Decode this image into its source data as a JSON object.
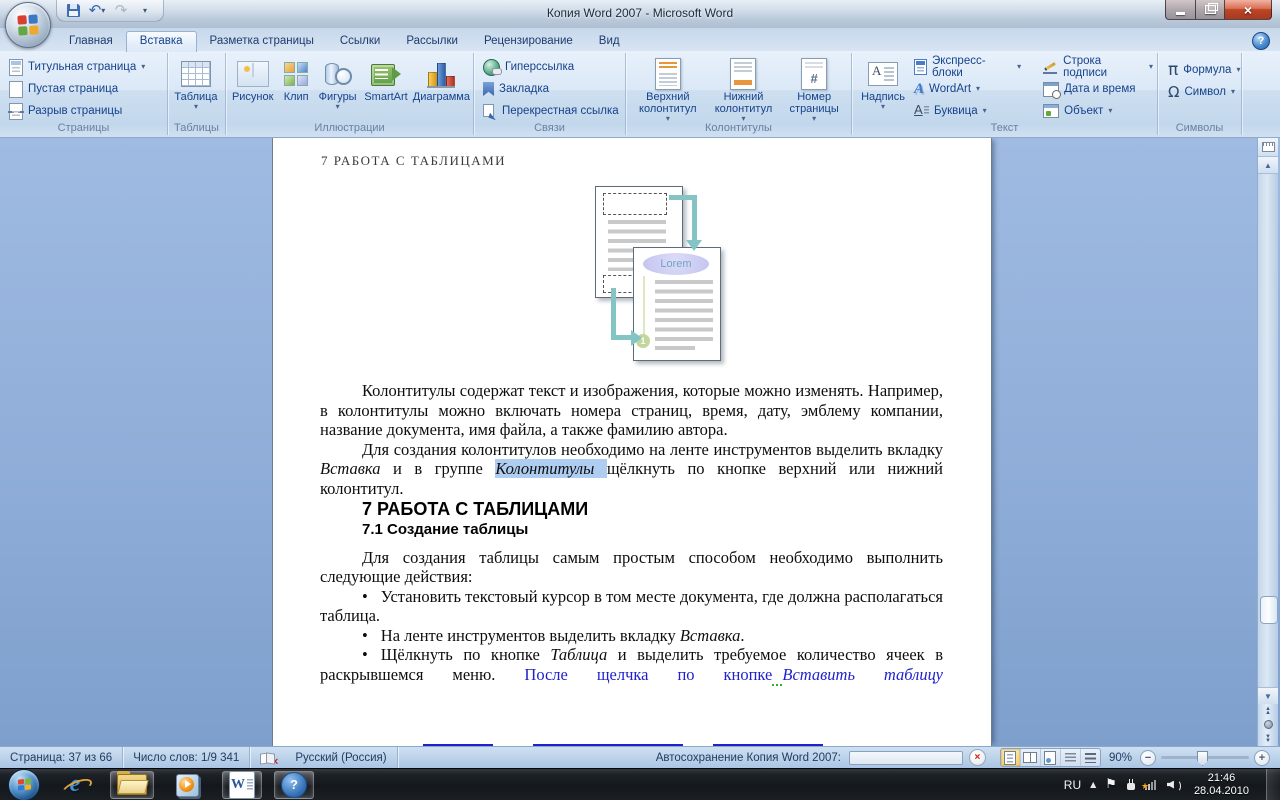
{
  "window": {
    "title": "Копия Word 2007 - Microsoft Word"
  },
  "ribbon": {
    "tabs": [
      "Главная",
      "Вставка",
      "Разметка страницы",
      "Ссылки",
      "Рассылки",
      "Рецензирование",
      "Вид"
    ],
    "groups": {
      "pages": {
        "label": "Страницы",
        "items": [
          "Титульная страница",
          "Пустая страница",
          "Разрыв страницы"
        ]
      },
      "tables": {
        "label": "Таблицы",
        "items": [
          "Таблица"
        ]
      },
      "illustrations": {
        "label": "Иллюстрации",
        "items": [
          "Рисунок",
          "Клип",
          "Фигуры",
          "SmartArt",
          "Диаграмма"
        ]
      },
      "links": {
        "label": "Связи",
        "items": [
          "Гиперссылка",
          "Закладка",
          "Перекрестная ссылка"
        ]
      },
      "header_footer": {
        "label": "Колонтитулы",
        "items": [
          "Верхний колонтитул",
          "Нижний колонтитул",
          "Номер страницы"
        ]
      },
      "text": {
        "label": "Текст",
        "items": [
          "Надпись",
          "Экспресс-блоки",
          "WordArt",
          "Буквица",
          "Строка подписи",
          "Дата и время",
          "Объект"
        ]
      },
      "symbols": {
        "label": "Символы",
        "items": [
          "Формула",
          "Символ"
        ]
      }
    }
  },
  "document": {
    "running_header": "7 РАБОТА С ТАБЛИЦАМИ",
    "figure": {
      "oval_label": "Lorem",
      "badge": "1"
    },
    "para1": "Колонтитулы содержат текст и изображения, которые можно изменять. Например, в колонтитулы можно включать номера страниц, время, дату, эмблему компании, название документа, имя файла, а также фамилию автора.",
    "para2": {
      "r1": "Для создания колонтитулов необходимо на ленте инструментов выделить вкладку ",
      "r2": "Вставка",
      "r3": " и в группе ",
      "r4": "Колонтитулы ",
      "r5": "щёлкнуть по кнопке верхний или нижний колонтитул."
    },
    "heading": "7 РАБОТА С ТАБЛИЦАМИ",
    "subheading": "7.1 Создание таблицы",
    "para3": "Для создания таблицы самым простым способом необходимо выполнить следующие действия:",
    "bullet_char": "•",
    "bullet1": "Установить текстовый курсор в том месте документа, где должна располагаться таблица.",
    "bullet2": {
      "r1": "На ленте инструментов выделить вкладку ",
      "r2": "Вставка",
      "r3": "."
    },
    "bullet3": {
      "r1": "Щёлкнуть по кнопке ",
      "r2": "Таблица",
      "r3": " и выделить требуемое количество ячеек в раскрывшемся меню. ",
      "r4": "После щелчка по кнопке",
      "r5": "Вставить таблицу"
    }
  },
  "status_bar": {
    "page_indicator": "Страница: 37 из 66",
    "word_count": "Число слов: 1/9 341",
    "language": "Русский (Россия)",
    "autosave_label": "Автосохранение Копия Word 2007:",
    "zoom_level": "90%"
  },
  "tray": {
    "language": "RU",
    "time": "21:46",
    "date": "28.04.2010"
  },
  "colors": {
    "selection_highlight": "#aecdf0",
    "hyperlink_blue": "#1f1fcf",
    "squiggle_green": "#2fae2f",
    "arrow_teal": "#85c4c4",
    "oval_fill": "#c3c3f0",
    "badge_green": "#c3d69b"
  }
}
